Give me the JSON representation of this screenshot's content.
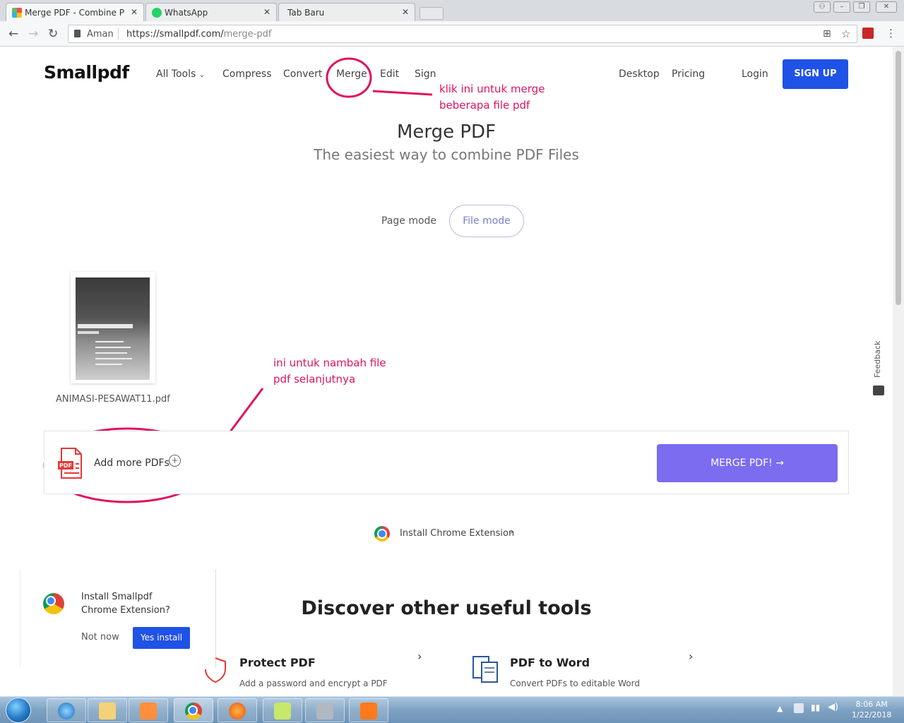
{
  "browser": {
    "tabs": [
      {
        "label": "Merge PDF - Combine P",
        "active": true
      },
      {
        "label": "WhatsApp",
        "active": false
      },
      {
        "label": "Tab Baru",
        "active": false
      }
    ],
    "secure_label": "Aman",
    "url_host": "https://smallpdf.com/",
    "url_path": "merge-pdf"
  },
  "header": {
    "logo": "Smallpdf",
    "nav": {
      "all_tools": "All Tools",
      "compress": "Compress",
      "convert": "Convert",
      "merge": "Merge",
      "edit": "Edit",
      "sign": "Sign",
      "desktop": "Desktop",
      "pricing": "Pricing",
      "login": "Login"
    },
    "signup": "SIGN UP"
  },
  "annotations": {
    "merge_note_1": "klik ini untuk merge",
    "merge_note_2": "beberapa file pdf",
    "add_note_1": "ini untuk nambah file",
    "add_note_2": "pdf selanjutnya"
  },
  "main": {
    "title": "Merge PDF",
    "subtitle": "The easiest way to combine PDF Files",
    "modes": {
      "page": "Page mode",
      "file": "File mode"
    },
    "file_name": "ANIMASI-PESAWAT11.pdf",
    "add_more": "Add more PDFs",
    "merge_button": "MERGE PDF!",
    "chrome_extension": "Install Chrome Extension"
  },
  "popup": {
    "text_line1": "Install Smallpdf",
    "text_line2": "Chrome Extension?",
    "not_now": "Not now",
    "yes_install": "Yes install"
  },
  "discover": {
    "title": "Discover other useful tools",
    "tools": [
      {
        "title": "Protect PDF",
        "desc": "Add a password and encrypt a PDF"
      },
      {
        "title": "PDF to Word",
        "desc": "Convert PDFs to editable Word"
      }
    ]
  },
  "feedback": "Feedback",
  "taskbar": {
    "time": "8:06 AM",
    "date": "1/22/2018"
  },
  "colors": {
    "accent_blue": "#1f52e6",
    "merge_purple": "#7b6cf0",
    "annotation_red": "#e0125f"
  }
}
